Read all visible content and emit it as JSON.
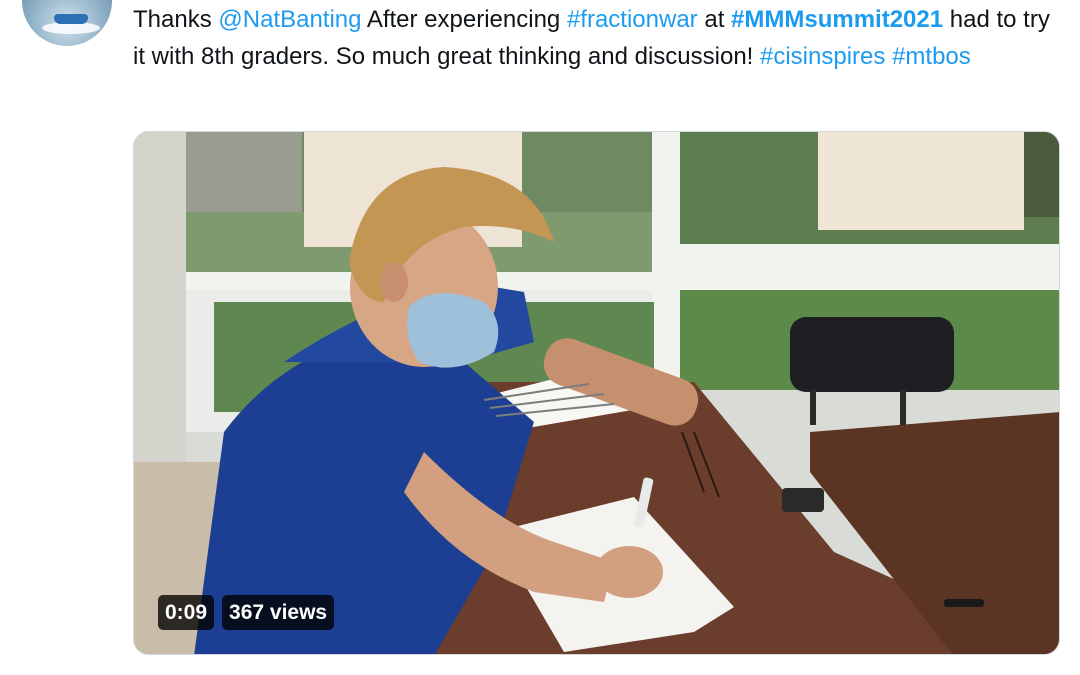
{
  "tweet": {
    "segments": [
      {
        "text": "Thanks ",
        "style": "plain"
      },
      {
        "text": "@NatBanting",
        "style": "link"
      },
      {
        "text": "  After experiencing ",
        "style": "plain"
      },
      {
        "text": "#fractionwar",
        "style": "link"
      },
      {
        "text": " at ",
        "style": "plain"
      },
      {
        "text": "#MMMsummit2021",
        "style": "link-bold"
      },
      {
        "text": " had to try it with 8th graders. So much great thinking and discussion! ",
        "style": "plain"
      },
      {
        "text": "#cisinspires",
        "style": "link"
      },
      {
        "text": " ",
        "style": "plain"
      },
      {
        "text": "#mtbos",
        "style": "link"
      }
    ]
  },
  "video": {
    "duration": "0:09",
    "views": "367 views"
  },
  "colors": {
    "link": "#1d9bf0",
    "text": "#0f1419",
    "badge_bg": "#000000c7"
  },
  "icons": {
    "avatar": "profile-avatar-boat"
  }
}
